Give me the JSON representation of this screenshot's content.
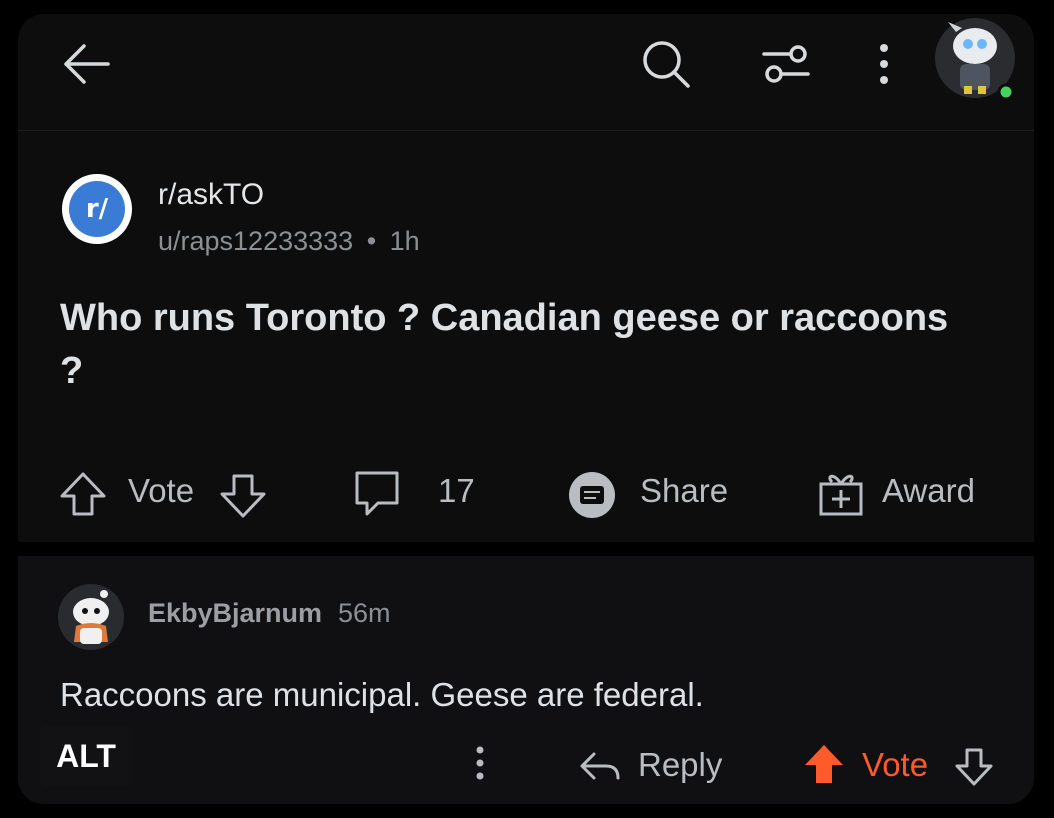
{
  "topbar": {
    "back_icon": "arrow-left-icon",
    "search_icon": "search-icon",
    "filter_icon": "sliders-icon",
    "more_icon": "vertical-dots-icon",
    "user_avatar_status": "online"
  },
  "post": {
    "subreddit": "r/askTO",
    "subreddit_icon_text": "r/",
    "author": "u/raps12233333",
    "separator": "•",
    "age": "1h",
    "title": "Who runs Toronto ? Canadian geese or raccoons ?",
    "actions": {
      "vote_label": "Vote",
      "comments_count": "17",
      "share_label": "Share",
      "award_label": "Award"
    }
  },
  "comment": {
    "author": "EkbyBjarnum",
    "age": "56m",
    "body": "Raccoons are municipal. Geese are federal.",
    "alt_label": "ALT",
    "reply_label": "Reply",
    "vote_label": "Vote",
    "upvote_color": "#ff5a2a"
  },
  "colors": {
    "background": "#0d0d0e",
    "text_primary": "#dfe2e5",
    "text_secondary": "#8c8f94",
    "subreddit_icon": "#3a7bd5",
    "online_dot": "#46d160"
  }
}
